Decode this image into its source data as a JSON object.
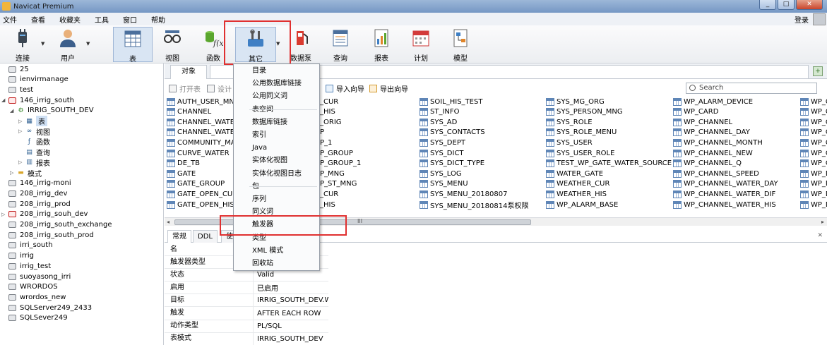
{
  "window": {
    "title": "Navicat Premium",
    "buttons": [
      "_",
      "□",
      "✕"
    ]
  },
  "menubar": {
    "items": [
      "文件",
      "查看",
      "收藏夹",
      "工具",
      "窗口",
      "帮助"
    ],
    "login": "登录"
  },
  "toolbar": {
    "items": [
      {
        "key": "connect",
        "label": "连接",
        "icon": "plug-icon"
      },
      {
        "key": "user",
        "label": "用户",
        "icon": "user-icon"
      },
      {
        "key": "table",
        "label": "表",
        "icon": "table-icon"
      },
      {
        "key": "view",
        "label": "视图",
        "icon": "glasses-icon"
      },
      {
        "key": "function",
        "label": "函数",
        "icon": "function-icon"
      },
      {
        "key": "other",
        "label": "其它",
        "icon": "tools-icon"
      },
      {
        "key": "datapump",
        "label": "数据泵",
        "icon": "fuel-pump-icon"
      },
      {
        "key": "query",
        "label": "查询",
        "icon": "query-icon"
      },
      {
        "key": "report",
        "label": "报表",
        "icon": "report-icon"
      },
      {
        "key": "schedule",
        "label": "计划",
        "icon": "calendar-icon"
      },
      {
        "key": "model",
        "label": "模型",
        "icon": "model-icon"
      }
    ]
  },
  "sidebar": {
    "rows": [
      {
        "text": "25",
        "indent": 0,
        "kind": "conn"
      },
      {
        "text": "ienvirmanage",
        "indent": 0,
        "kind": "conn"
      },
      {
        "text": "test",
        "indent": 0,
        "kind": "conn"
      },
      {
        "text": "146_irrig_south",
        "indent": 0,
        "kind": "conn-red",
        "toggle": "◢"
      },
      {
        "text": "IRRIG_SOUTH_DEV",
        "indent": 1,
        "kind": "schema",
        "toggle": "◢"
      },
      {
        "text": "表",
        "indent": 2,
        "kind": "table",
        "toggle": "▷",
        "selected": true
      },
      {
        "text": "视图",
        "indent": 2,
        "kind": "view",
        "toggle": "▷"
      },
      {
        "text": "函数",
        "indent": 2,
        "kind": "func"
      },
      {
        "text": "查询",
        "indent": 2,
        "kind": "query"
      },
      {
        "text": "报表",
        "indent": 2,
        "kind": "report",
        "toggle": "▷"
      },
      {
        "text": "模式",
        "indent": 1,
        "kind": "folder",
        "toggle": "▷"
      },
      {
        "text": "146_irrig-moni",
        "indent": 0,
        "kind": "conn"
      },
      {
        "text": "208_irrig_dev",
        "indent": 0,
        "kind": "conn"
      },
      {
        "text": "208_irrig_prod",
        "indent": 0,
        "kind": "conn"
      },
      {
        "text": "208_irrig_souh_dev",
        "indent": 0,
        "kind": "conn-red",
        "toggle": "▷"
      },
      {
        "text": "208_irrig_south_exchange",
        "indent": 0,
        "kind": "conn"
      },
      {
        "text": "208_irrig_south_prod",
        "indent": 0,
        "kind": "conn"
      },
      {
        "text": "irri_south",
        "indent": 0,
        "kind": "conn"
      },
      {
        "text": "irrig",
        "indent": 0,
        "kind": "conn"
      },
      {
        "text": "irrig_test",
        "indent": 0,
        "kind": "conn"
      },
      {
        "text": "suoyasong_irri",
        "indent": 0,
        "kind": "conn"
      },
      {
        "text": "WRORDOS",
        "indent": 0,
        "kind": "conn"
      },
      {
        "text": "wrordos_new",
        "indent": 0,
        "kind": "conn"
      },
      {
        "text": "SQLServer249_2433",
        "indent": 0,
        "kind": "conn"
      },
      {
        "text": "SQLSever249",
        "indent": 0,
        "kind": "conn"
      }
    ]
  },
  "main": {
    "tab_label": "对象",
    "object_toolbar": {
      "open": "打开表",
      "design": "设计",
      "import": "导入向导",
      "export": "导出向导"
    },
    "search_placeholder": "Search",
    "tables": [
      [
        "AUTH_USER_MNG",
        "CHANNEL",
        "CHANNEL_WATE",
        "CHANNEL_WATE",
        "COMMUNITY_MA",
        "CURVE_WATER",
        "DE_TB",
        "GATE",
        "GATE_GROUP",
        "GATE_OPEN_CUR",
        "GATE_OPEN_HIS"
      ],
      [
        "_CUR",
        "_HIS",
        "_ORIG",
        "P",
        "P_1",
        "P_GROUP",
        "P_GROUP_1",
        "P_MNG",
        "P_ST_MNG",
        "_CUR",
        "_HIS"
      ],
      [
        "SOIL_HIS_TEST",
        "ST_INFO",
        "SYS_AD",
        "SYS_CONTACTS",
        "SYS_DEPT",
        "SYS_DICT",
        "SYS_DICT_TYPE",
        "SYS_LOG",
        "SYS_MENU",
        "SYS_MENU_20180807",
        "SYS_MENU_20180814泵权限"
      ],
      [
        "SYS_MG_ORG",
        "SYS_PERSON_MNG",
        "SYS_ROLE",
        "SYS_ROLE_MENU",
        "SYS_USER",
        "SYS_USER_ROLE",
        "TEST_WP_GATE_WATER_SOURCE",
        "WATER_GATE",
        "WEATHER_CUR",
        "WEATHER_HIS",
        "WP_ALARM_BASE"
      ],
      [
        "WP_ALARM_DEVICE",
        "WP_CARD",
        "WP_CHANNEL",
        "WP_CHANNEL_DAY",
        "WP_CHANNEL_MONTH",
        "WP_CHANNEL_NEW",
        "WP_CHANNEL_Q",
        "WP_CHANNEL_SPEED",
        "WP_CHANNEL_WATER_DAY",
        "WP_CHANNEL_WATER_DIF",
        "WP_CHANNEL_WATER_HIS"
      ],
      [
        "WP_C",
        "WP_C",
        "WP_C",
        "WP_C",
        "WP_C",
        "WP_C",
        "WP_C",
        "WP_D",
        "WP_D",
        "WP_D",
        "WP_D"
      ]
    ],
    "scroll_thumb_text": "III",
    "prop_tabs": [
      "常规",
      "DDL",
      "使"
    ],
    "properties": [
      {
        "key": "名",
        "value": ""
      },
      {
        "key": "触发器类型",
        "value": ""
      },
      {
        "key": "状态",
        "value": "Valid"
      },
      {
        "key": "启用",
        "value": "已启用"
      },
      {
        "key": "目标",
        "value": "IRRIG_SOUTH_DEV.W"
      },
      {
        "key": "触发",
        "value": "AFTER EACH ROW"
      },
      {
        "key": "动作类型",
        "value": "PL/SQL"
      },
      {
        "key": "表模式",
        "value": "IRRIG_SOUTH_DEV"
      }
    ]
  },
  "dropdown": {
    "items": [
      "目录",
      "公用数据库链接",
      "公用同义词",
      "表空间",
      "数据库链接",
      "索引",
      "Java",
      "实体化视图",
      "实体化视图日志",
      "包",
      "序列",
      "同义词",
      "触发器",
      "类型",
      "XML 模式",
      "回收站"
    ],
    "highlighted": "触发器"
  },
  "colors": {
    "highlight": "#e03030",
    "accent": "#2a5c8f"
  }
}
